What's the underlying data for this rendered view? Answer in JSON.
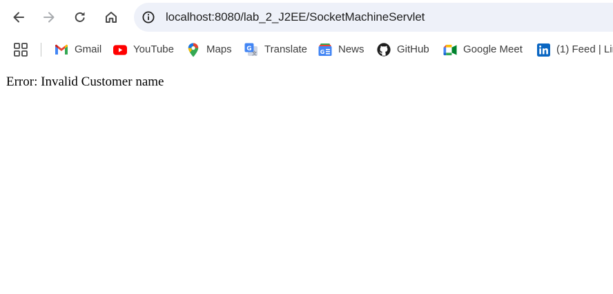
{
  "browser": {
    "url": "localhost:8080/lab_2_J2EE/SocketMachineServlet",
    "bookmarks": [
      {
        "label": "Gmail",
        "icon": "gmail-icon"
      },
      {
        "label": "YouTube",
        "icon": "youtube-icon"
      },
      {
        "label": "Maps",
        "icon": "maps-icon"
      },
      {
        "label": "Translate",
        "icon": "translate-icon"
      },
      {
        "label": "News",
        "icon": "news-icon"
      },
      {
        "label": "GitHub",
        "icon": "github-icon"
      },
      {
        "label": "Google Meet",
        "icon": "meet-icon"
      },
      {
        "label": "(1) Feed | Lin",
        "icon": "linkedin-icon"
      }
    ]
  },
  "page": {
    "message": "Error: Invalid Customer name"
  },
  "colors": {
    "omnibox_bg": "#eef1f9",
    "icon_gray": "#474747",
    "icon_disabled": "#a8abaf",
    "text": "#1f1f1f"
  }
}
